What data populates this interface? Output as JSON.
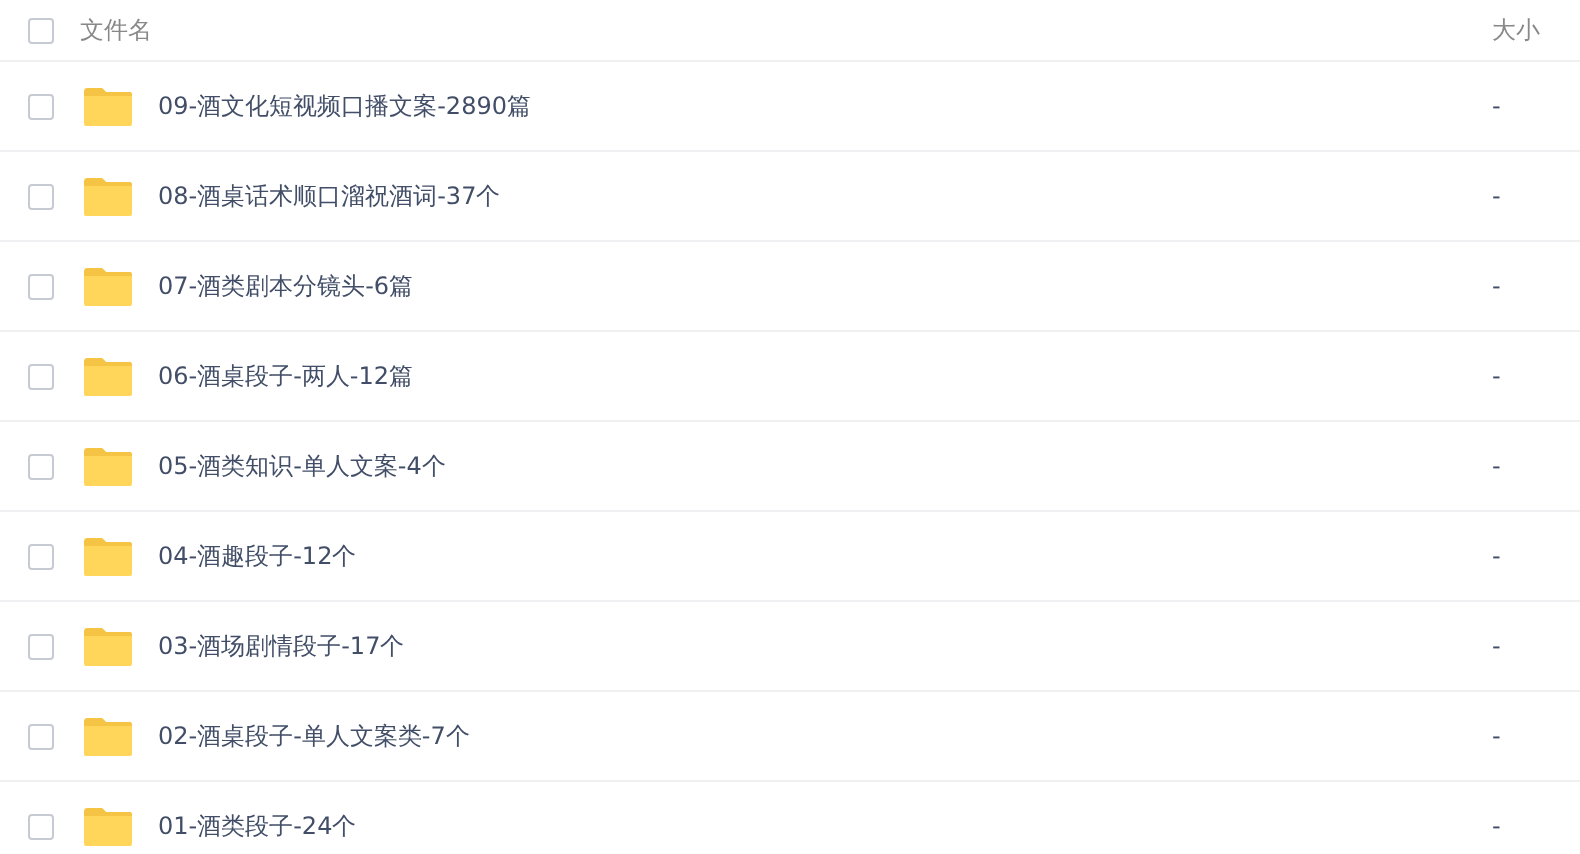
{
  "header": {
    "checked": false,
    "name_label": "文件名",
    "size_label": "大小"
  },
  "files": [
    {
      "name": "09-酒文化短视频口播文案-2890篇",
      "size": "-",
      "checked": false
    },
    {
      "name": "08-酒桌话术顺口溜祝酒词-37个",
      "size": "-",
      "checked": false
    },
    {
      "name": "07-酒类剧本分镜头-6篇",
      "size": "-",
      "checked": false
    },
    {
      "name": "06-酒桌段子-两人-12篇",
      "size": "-",
      "checked": false
    },
    {
      "name": "05-酒类知识-单人文案-4个",
      "size": "-",
      "checked": false
    },
    {
      "name": "04-酒趣段子-12个",
      "size": "-",
      "checked": false
    },
    {
      "name": "03-酒场剧情段子-17个",
      "size": "-",
      "checked": false
    },
    {
      "name": "02-酒桌段子-单人文案类-7个",
      "size": "-",
      "checked": false
    },
    {
      "name": "01-酒类段子-24个",
      "size": "-",
      "checked": false
    }
  ]
}
